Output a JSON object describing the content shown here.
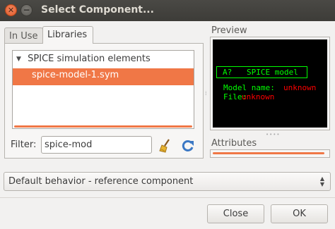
{
  "window": {
    "title": "Select Component..."
  },
  "tabs": [
    {
      "label": "In Use",
      "active": false
    },
    {
      "label": "Libraries",
      "active": true
    }
  ],
  "library_tree": {
    "group_label": "SPICE simulation elements",
    "selected_item": "spice-model-1.sym"
  },
  "filter": {
    "label": "Filter:",
    "value": "spice-mod",
    "clear_icon": "broom-icon",
    "refresh_icon": "refresh-icon"
  },
  "preview": {
    "label": "Preview",
    "refdes": "A?",
    "symbol_label": "SPICE model",
    "model_name_key": "Model name:",
    "model_name_value": "unknown",
    "file_key": "File:",
    "file_value": "unknown",
    "colors": {
      "background": "#000000",
      "graphics": "#00ff00",
      "attribute_value": "#ff0000"
    }
  },
  "attributes": {
    "label": "Attributes"
  },
  "behavior": {
    "selected": "Default behavior - reference component"
  },
  "buttons": {
    "close": "Close",
    "ok": "OK"
  },
  "accent_color": "#f07746"
}
